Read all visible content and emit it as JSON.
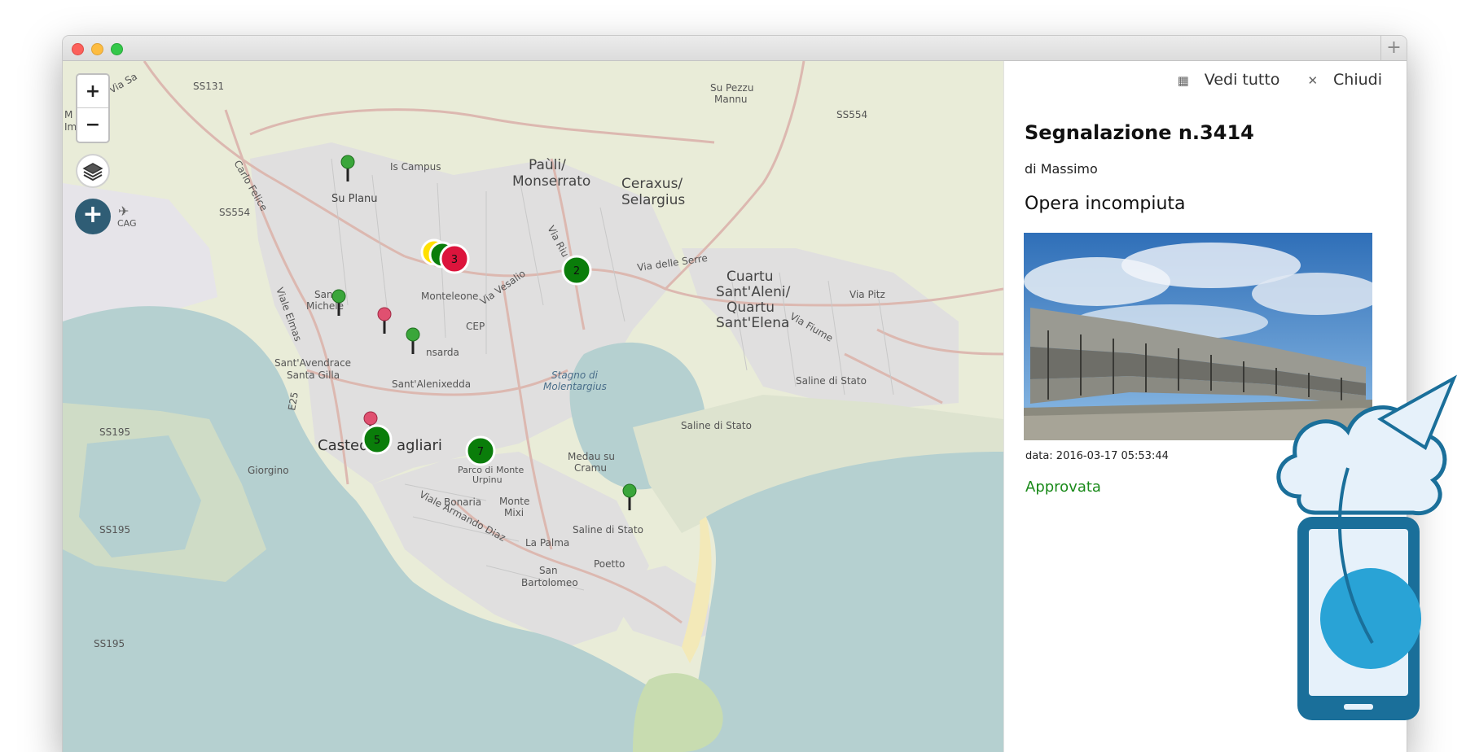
{
  "window": {
    "new_tab_label": "+"
  },
  "map": {
    "zoom_in_label": "+",
    "zoom_out_label": "−",
    "add_label": "+",
    "labels": {
      "ss131": "SS131",
      "ss554_left": "SS554",
      "ss554_right": "SS554",
      "ss195_a": "SS195",
      "ss195_b": "SS195",
      "ss195_c": "SS195",
      "carlo_felice": "Carlo Felice",
      "via_sa": "Via Sa",
      "is_campus": "Is Campus",
      "su_planu": "Su Planu",
      "cag": "CAG",
      "pauli": "Paùli/",
      "monserrato": "Monserrato",
      "ceraxus": "Ceraxus/",
      "selargius": "Selargius",
      "su_pezzu": "Su Pezzu",
      "mannu": "Mannu",
      "via_riu": "Via Riu Mo",
      "via_delle_serre": "Via delle Serre",
      "cuartu": "Cuartu",
      "sant_aleni": "Sant'Aleni/",
      "quartu": "Quartu",
      "sant_elena": "Sant'Elena",
      "via_pitz": "Via Pitz",
      "via_fiume": "Via Fiume",
      "san": "San",
      "michele": "Michele",
      "viale_elmas": "Viale Elmas",
      "monteleone": "Monteleone",
      "via_vesalio": "Via Vesalio",
      "cep": "CEP",
      "pirri_sarda": "nsarda",
      "sant_avendrace": "Sant'Avendrace",
      "santa_gilla": "Santa Gilla",
      "sant_alenixedda": "Sant'Alenixedda",
      "stagno_di": "Stagno di",
      "molentargius": "Molentargius",
      "saline_a": "Saline di Stato",
      "saline_b": "Saline di Stato",
      "saline_c": "Saline di Stato",
      "e25": "E25",
      "giorgino": "Giorgino",
      "casteddu": "Castedd",
      "agliari": "agliari",
      "parco": "Parco di Monte",
      "urpinu": "Urpinu",
      "medau": "Medau su",
      "cramu": "Cramu",
      "bonaria": "Bonaria",
      "monte": "Monte",
      "mixi": "Mixi",
      "viale_armando": "Viale Armando Diaz",
      "la_palma": "La Palma",
      "san2": "San",
      "bartolomeo": "Bartolomeo",
      "poetto": "Poetto",
      "m_i": "M",
      "m_i2": "Im"
    },
    "clusters": [
      {
        "count": "3",
        "color": "#dc143c"
      },
      {
        "count": "2",
        "color": "#0a7d0a"
      },
      {
        "count": "5",
        "color": "#0a7d0a"
      },
      {
        "count": "7",
        "color": "#0a7d0a"
      }
    ],
    "pins": [
      {
        "color": "green"
      },
      {
        "color": "green"
      },
      {
        "color": "red"
      },
      {
        "color": "green"
      },
      {
        "color": "red"
      },
      {
        "color": "green"
      }
    ]
  },
  "panel": {
    "view_all_icon": "list-icon",
    "view_all_label": "Vedi tutto",
    "close_icon": "close-icon",
    "close_label": "Chiudi",
    "title": "Segnalazione n.3414",
    "author": "di Massimo",
    "category": "Opera incompiuta",
    "date": "data: 2016-03-17 05:53:44",
    "status": "Approvata",
    "status_color": "#1a8a1a"
  },
  "colors": {
    "land": "#e9ecd8",
    "water": "#b5d0d0",
    "urban": "#e0dfdf",
    "road": "#dcb8b0",
    "add_button": "#2f5d75",
    "logo_blue": "#1a6f9a"
  }
}
